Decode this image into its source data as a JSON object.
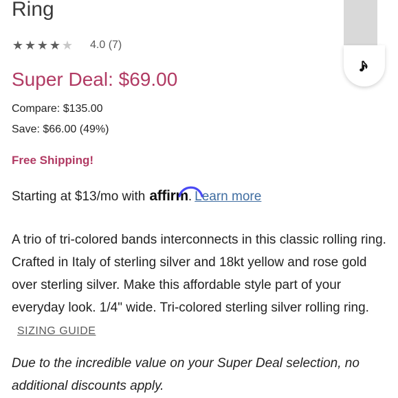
{
  "product": {
    "title": "Ring",
    "rating": {
      "value": 4,
      "max": 5,
      "text": "4.0 (7)"
    },
    "super_deal": "Super Deal: $69.00",
    "compare": "Compare: $135.00",
    "save": "Save: $66.00 (49%)",
    "shipping": "Free Shipping!",
    "financing": {
      "prefix": "Starting at $13/mo with",
      "brand": "affirm",
      "suffix": ".",
      "link": "Learn more"
    },
    "description": "A trio of tri-colored bands interconnects in this classic rolling ring. Crafted in Italy of sterling silver and 18kt yellow and rose gold over sterling silver. Make this affordable style part of your everyday look. 1/4\" wide. Tri-colored sterling silver rolling ring.",
    "sizing_guide": "SIZING GUIDE",
    "disclaimer": "Due to the incredible value on your Super Deal selection, no additional discounts apply."
  },
  "side_widget": {
    "icon": "music-note-icon"
  },
  "colors": {
    "accent": "#b13a63",
    "link": "#3f6da1",
    "affirm_arc": "#4a4af4"
  }
}
